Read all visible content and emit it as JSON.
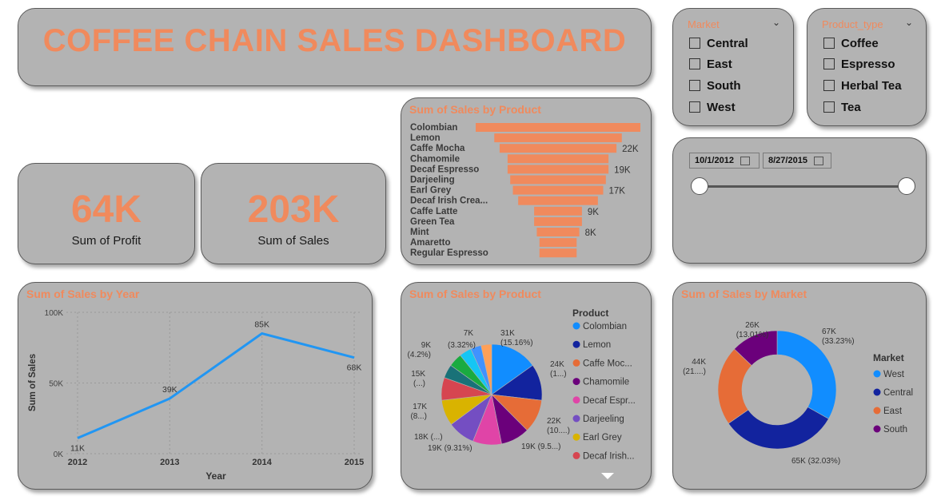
{
  "title": "COFFEE CHAIN SALES DASHBOARD",
  "kpis": {
    "profit": {
      "value": "64K",
      "label": "Sum of Profit"
    },
    "sales": {
      "value": "203K",
      "label": "Sum of Sales"
    }
  },
  "slicers": {
    "market": {
      "header": "Market",
      "items": [
        "Central",
        "East",
        "South",
        "West"
      ]
    },
    "product_type": {
      "header": "Product_type",
      "items": [
        "Coffee",
        "Espresso",
        "Herbal Tea",
        "Tea"
      ]
    }
  },
  "date_range": {
    "start": "10/1/2012",
    "end": "8/27/2015"
  },
  "colors": {
    "accent": "#f08a5d",
    "card_bg": "#b3b3b3",
    "line": "#2196f3"
  },
  "chart_data": [
    {
      "type": "bar",
      "title": "Sum of Sales by Product",
      "orientation": "horizontal-funnel",
      "categories": [
        "Colombian",
        "Lemon",
        "Caffe Mocha",
        "Chamomile",
        "Decaf Espresso",
        "Darjeeling",
        "Earl Grey",
        "Decaf Irish Crea...",
        "Caffe Latte",
        "Green Tea",
        "Mint",
        "Amaretto",
        "Regular Espresso"
      ],
      "values": [
        31,
        24,
        22,
        19,
        19,
        18,
        17,
        15,
        9,
        9,
        8,
        7,
        7
      ],
      "data_labels": [
        "",
        "",
        "22K",
        "",
        "19K",
        "",
        "17K",
        "",
        "9K",
        "",
        "8K",
        "",
        ""
      ]
    },
    {
      "type": "line",
      "title": "Sum of Sales by Year",
      "xlabel": "Year",
      "ylabel": "Sum of Sales",
      "x": [
        "2012",
        "2013",
        "2014",
        "2015"
      ],
      "values": [
        11,
        39,
        85,
        68
      ],
      "point_labels": [
        "11K",
        "39K",
        "85K",
        "68K"
      ],
      "y_ticks": [
        "0K",
        "50K",
        "100K"
      ],
      "ylim": [
        0,
        100
      ]
    },
    {
      "type": "pie",
      "title": "Sum of Sales by Product",
      "legend_title": "Product",
      "legend": [
        "Colombian",
        "Lemon",
        "Caffe Moc...",
        "Chamomile",
        "Decaf Espr...",
        "Darjeeling",
        "Earl Grey",
        "Decaf Irish..."
      ],
      "slices": [
        {
          "value": 31,
          "color": "#118dff",
          "label1": "31K",
          "label2": "(15.16%)"
        },
        {
          "value": 24,
          "color": "#12239e",
          "label1": "24K",
          "label2": "(1...)"
        },
        {
          "value": 22,
          "color": "#e66c37",
          "label1": "22K",
          "label2": "(10....)"
        },
        {
          "value": 19,
          "color": "#6b007b",
          "label1": "19K (9.5...)",
          "label2": ""
        },
        {
          "value": 19,
          "color": "#e044a7",
          "label1": "19K (9.31%)",
          "label2": ""
        },
        {
          "value": 18,
          "color": "#744ec2",
          "label1": "18K (...)",
          "label2": ""
        },
        {
          "value": 17,
          "color": "#d9b300",
          "label1": "17K",
          "label2": "(8...)"
        },
        {
          "value": 15,
          "color": "#d64550",
          "label1": "15K",
          "label2": "(...)"
        },
        {
          "value": 9,
          "color": "#197278",
          "label1": "",
          "label2": ""
        },
        {
          "value": 9,
          "color": "#1aab40",
          "label1": "9K",
          "label2": "(4.2%)"
        },
        {
          "value": 8,
          "color": "#15c6f4",
          "label1": "",
          "label2": ""
        },
        {
          "value": 7,
          "color": "#4092ff",
          "label1": "",
          "label2": ""
        },
        {
          "value": 7,
          "color": "#ffa058",
          "label1": "7K",
          "label2": ""
        }
      ],
      "extra_labels": [
        "(3.32%)"
      ]
    },
    {
      "type": "pie",
      "title": "Sum of Sales by Market",
      "legend_title": "Market",
      "legend": [
        "West",
        "Central",
        "East",
        "South"
      ],
      "slices": [
        {
          "name": "West",
          "value": 67,
          "color": "#118dff",
          "label1": "67K",
          "label2": "(33.23%)"
        },
        {
          "name": "Central",
          "value": 65,
          "color": "#12239e",
          "label1": "65K (32.03%)",
          "label2": ""
        },
        {
          "name": "East",
          "value": 44,
          "color": "#e66c37",
          "label1": "44K",
          "label2": "(21....)"
        },
        {
          "name": "South",
          "value": 26,
          "color": "#6b007b",
          "label1": "26K",
          "label2": "(13.01%)"
        }
      ]
    }
  ]
}
